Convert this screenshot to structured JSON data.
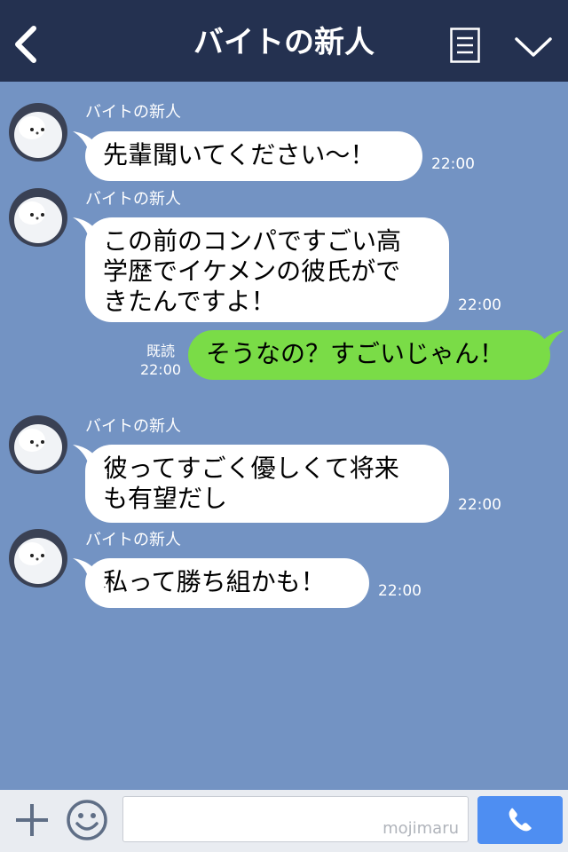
{
  "header": {
    "title": "バイトの新人"
  },
  "messages": [
    {
      "sender": "バイトの新人",
      "lines": [
        "先輩聞いてください〜！"
      ],
      "time": "22:00"
    },
    {
      "sender": "バイトの新人",
      "lines": [
        "この前のコンパですごい高",
        "学歴でイケメンの彼氏がで",
        "きたんですよ！"
      ],
      "time": "22:00"
    },
    {
      "lines": [
        "そうなの？すごいじゃん！"
      ],
      "read": "既読",
      "time": "22:00"
    },
    {
      "sender": "バイトの新人",
      "lines": [
        "彼ってすごく優しくて将来",
        "も有望だし"
      ],
      "time": "22:00"
    },
    {
      "sender": "バイトの新人",
      "lines": [
        "私って勝ち組かも！"
      ],
      "time": "22:00"
    }
  ],
  "input": {
    "watermark": "mojimaru"
  },
  "colors": {
    "header_bg": "#243150",
    "chat_bg": "#7393c3",
    "outgoing_bubble": "#7adc47",
    "incoming_bubble": "#ffffff",
    "call_button": "#4e8ef2"
  },
  "icons": [
    "back-icon",
    "menu-icon",
    "chevron-down-icon",
    "plus-icon",
    "smiley-icon",
    "phone-icon"
  ]
}
